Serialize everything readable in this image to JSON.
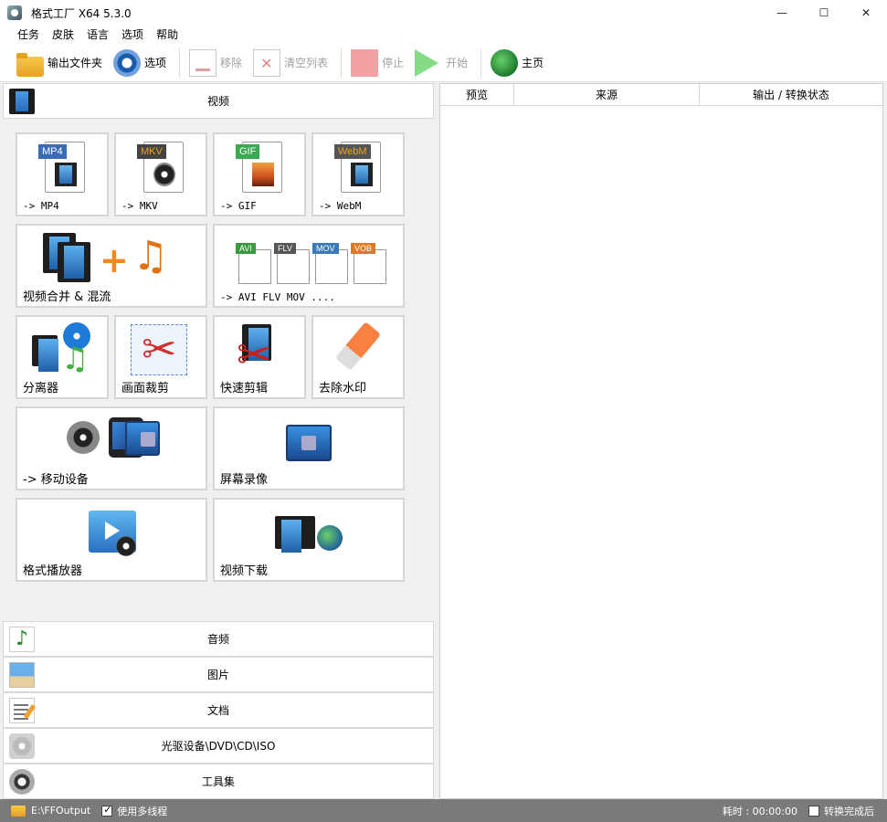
{
  "window": {
    "title": "格式工厂 X64 5.3.0",
    "controls": {
      "minimize": "—",
      "maximize": "☐",
      "close": "✕"
    }
  },
  "menu": [
    "任务",
    "皮肤",
    "语言",
    "选项",
    "帮助"
  ],
  "toolbar": {
    "output_folder": "输出文件夹",
    "options": "选项",
    "remove": "移除",
    "clear_list": "清空列表",
    "stop": "停止",
    "start": "开始",
    "home": "主页"
  },
  "categories": {
    "video": "视频",
    "audio": "音频",
    "picture": "图片",
    "document": "文档",
    "disc": "光驱设备\\DVD\\CD\\ISO",
    "tools": "工具集"
  },
  "video_tiles": {
    "mp4": {
      "label": "-> MP4",
      "badge": "MP4"
    },
    "mkv": {
      "label": "-> MKV",
      "badge": "MKV"
    },
    "gif": {
      "label": "-> GIF",
      "badge": "GIF"
    },
    "webm": {
      "label": "-> WebM",
      "badge": "WebM"
    },
    "merge": {
      "label": "视频合并 & 混流"
    },
    "others": {
      "label": "-> AVI FLV MOV ....",
      "badges": [
        "AVI",
        "FLV",
        "MOV",
        "VOB"
      ]
    },
    "splitter": {
      "label": "分离器"
    },
    "crop": {
      "label": "画面裁剪"
    },
    "quick_clip": {
      "label": "快速剪辑"
    },
    "watermark": {
      "label": "去除水印"
    },
    "mobile": {
      "label": "-> 移动设备"
    },
    "screen_record": {
      "label": "屏幕录像"
    },
    "player": {
      "label": "格式播放器"
    },
    "download": {
      "label": "视频下载"
    }
  },
  "task_table": {
    "columns": [
      "预览",
      "来源",
      "输出 / 转换状态"
    ]
  },
  "statusbar": {
    "output_path": "E:\\FFOutput",
    "multithread_label": "使用多线程",
    "multithread_checked": true,
    "elapsed": "耗时 : 00:00:00",
    "after_done": "转换完成后"
  },
  "colors": {
    "mp4_badge": "#3a6ab8",
    "mkv_badge": "#444444",
    "gif_badge": "#3aaa50",
    "webm_badge": "#555555",
    "webm_badge_text": "#f0a020",
    "avi_badge": "#3a9a40",
    "flv_badge": "#555555",
    "mov_badge": "#3a7ab8",
    "vob_badge": "#e07a20"
  }
}
